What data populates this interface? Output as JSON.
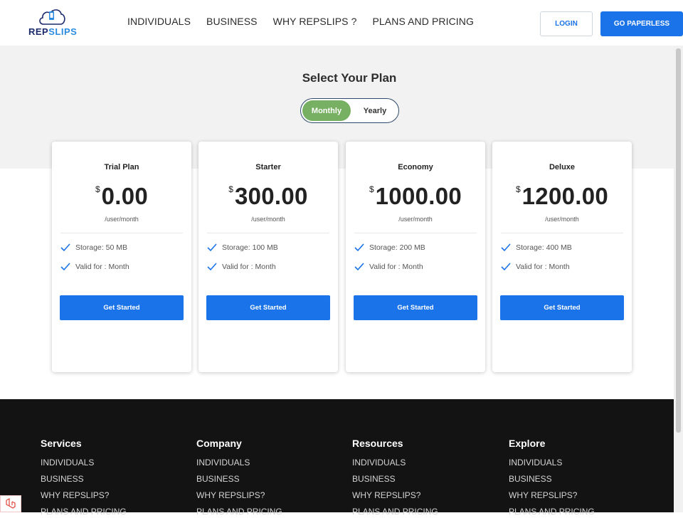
{
  "header": {
    "logo_text_a": "REP",
    "logo_text_b": "SLIPS",
    "nav": [
      "INDIVIDUALS",
      "BUSINESS",
      "WHY REPSLIPS ?",
      "PLANS AND PRICING"
    ],
    "login_label": "LOGIN",
    "paperless_label": "GO PAPERLESS"
  },
  "plans_section": {
    "title": "Select Your Plan",
    "toggle_active": "Monthly",
    "toggle_inactive": "Yearly"
  },
  "plans": [
    {
      "name": "Trial Plan",
      "currency": "$",
      "price": "0.00",
      "period": "/user/month",
      "features": [
        "Storage: 50 MB",
        "Valid for : Month"
      ],
      "cta": "Get Started"
    },
    {
      "name": "Starter",
      "currency": "$",
      "price": "300.00",
      "period": "/user/month",
      "features": [
        "Storage: 100 MB",
        "Valid for : Month"
      ],
      "cta": "Get Started"
    },
    {
      "name": "Economy",
      "currency": "$",
      "price": "1000.00",
      "period": "/user/month",
      "features": [
        "Storage: 200 MB",
        "Valid for : Month"
      ],
      "cta": "Get Started"
    },
    {
      "name": "Deluxe",
      "currency": "$",
      "price": "1200.00",
      "period": "/user/month",
      "features": [
        "Storage: 400 MB",
        "Valid for : Month"
      ],
      "cta": "Get Started"
    }
  ],
  "footer": {
    "columns": [
      {
        "heading": "Services",
        "links": [
          "INDIVIDUALS",
          "BUSINESS",
          "WHY REPSLIPS?",
          "PLANS AND PRICING"
        ]
      },
      {
        "heading": "Company",
        "links": [
          "INDIVIDUALS",
          "BUSINESS",
          "WHY REPSLIPS?",
          "PLANS AND PRICING"
        ]
      },
      {
        "heading": "Resources",
        "links": [
          "INDIVIDUALS",
          "BUSINESS",
          "WHY REPSLIPS?",
          "PLANS AND PRICING"
        ]
      },
      {
        "heading": "Explore",
        "links": [
          "INDIVIDUALS",
          "BUSINESS",
          "WHY REPSLIPS?",
          "PLANS AND PRICING"
        ]
      }
    ]
  },
  "colors": {
    "accent_blue": "#1a73e8",
    "toggle_green": "#77b063",
    "footer_bg": "#131313",
    "band_bg": "#f2f2f2"
  },
  "icons": {
    "logo": "cloud-phone-logo-icon",
    "feature": "check-icon",
    "corner": "laravel-icon"
  }
}
